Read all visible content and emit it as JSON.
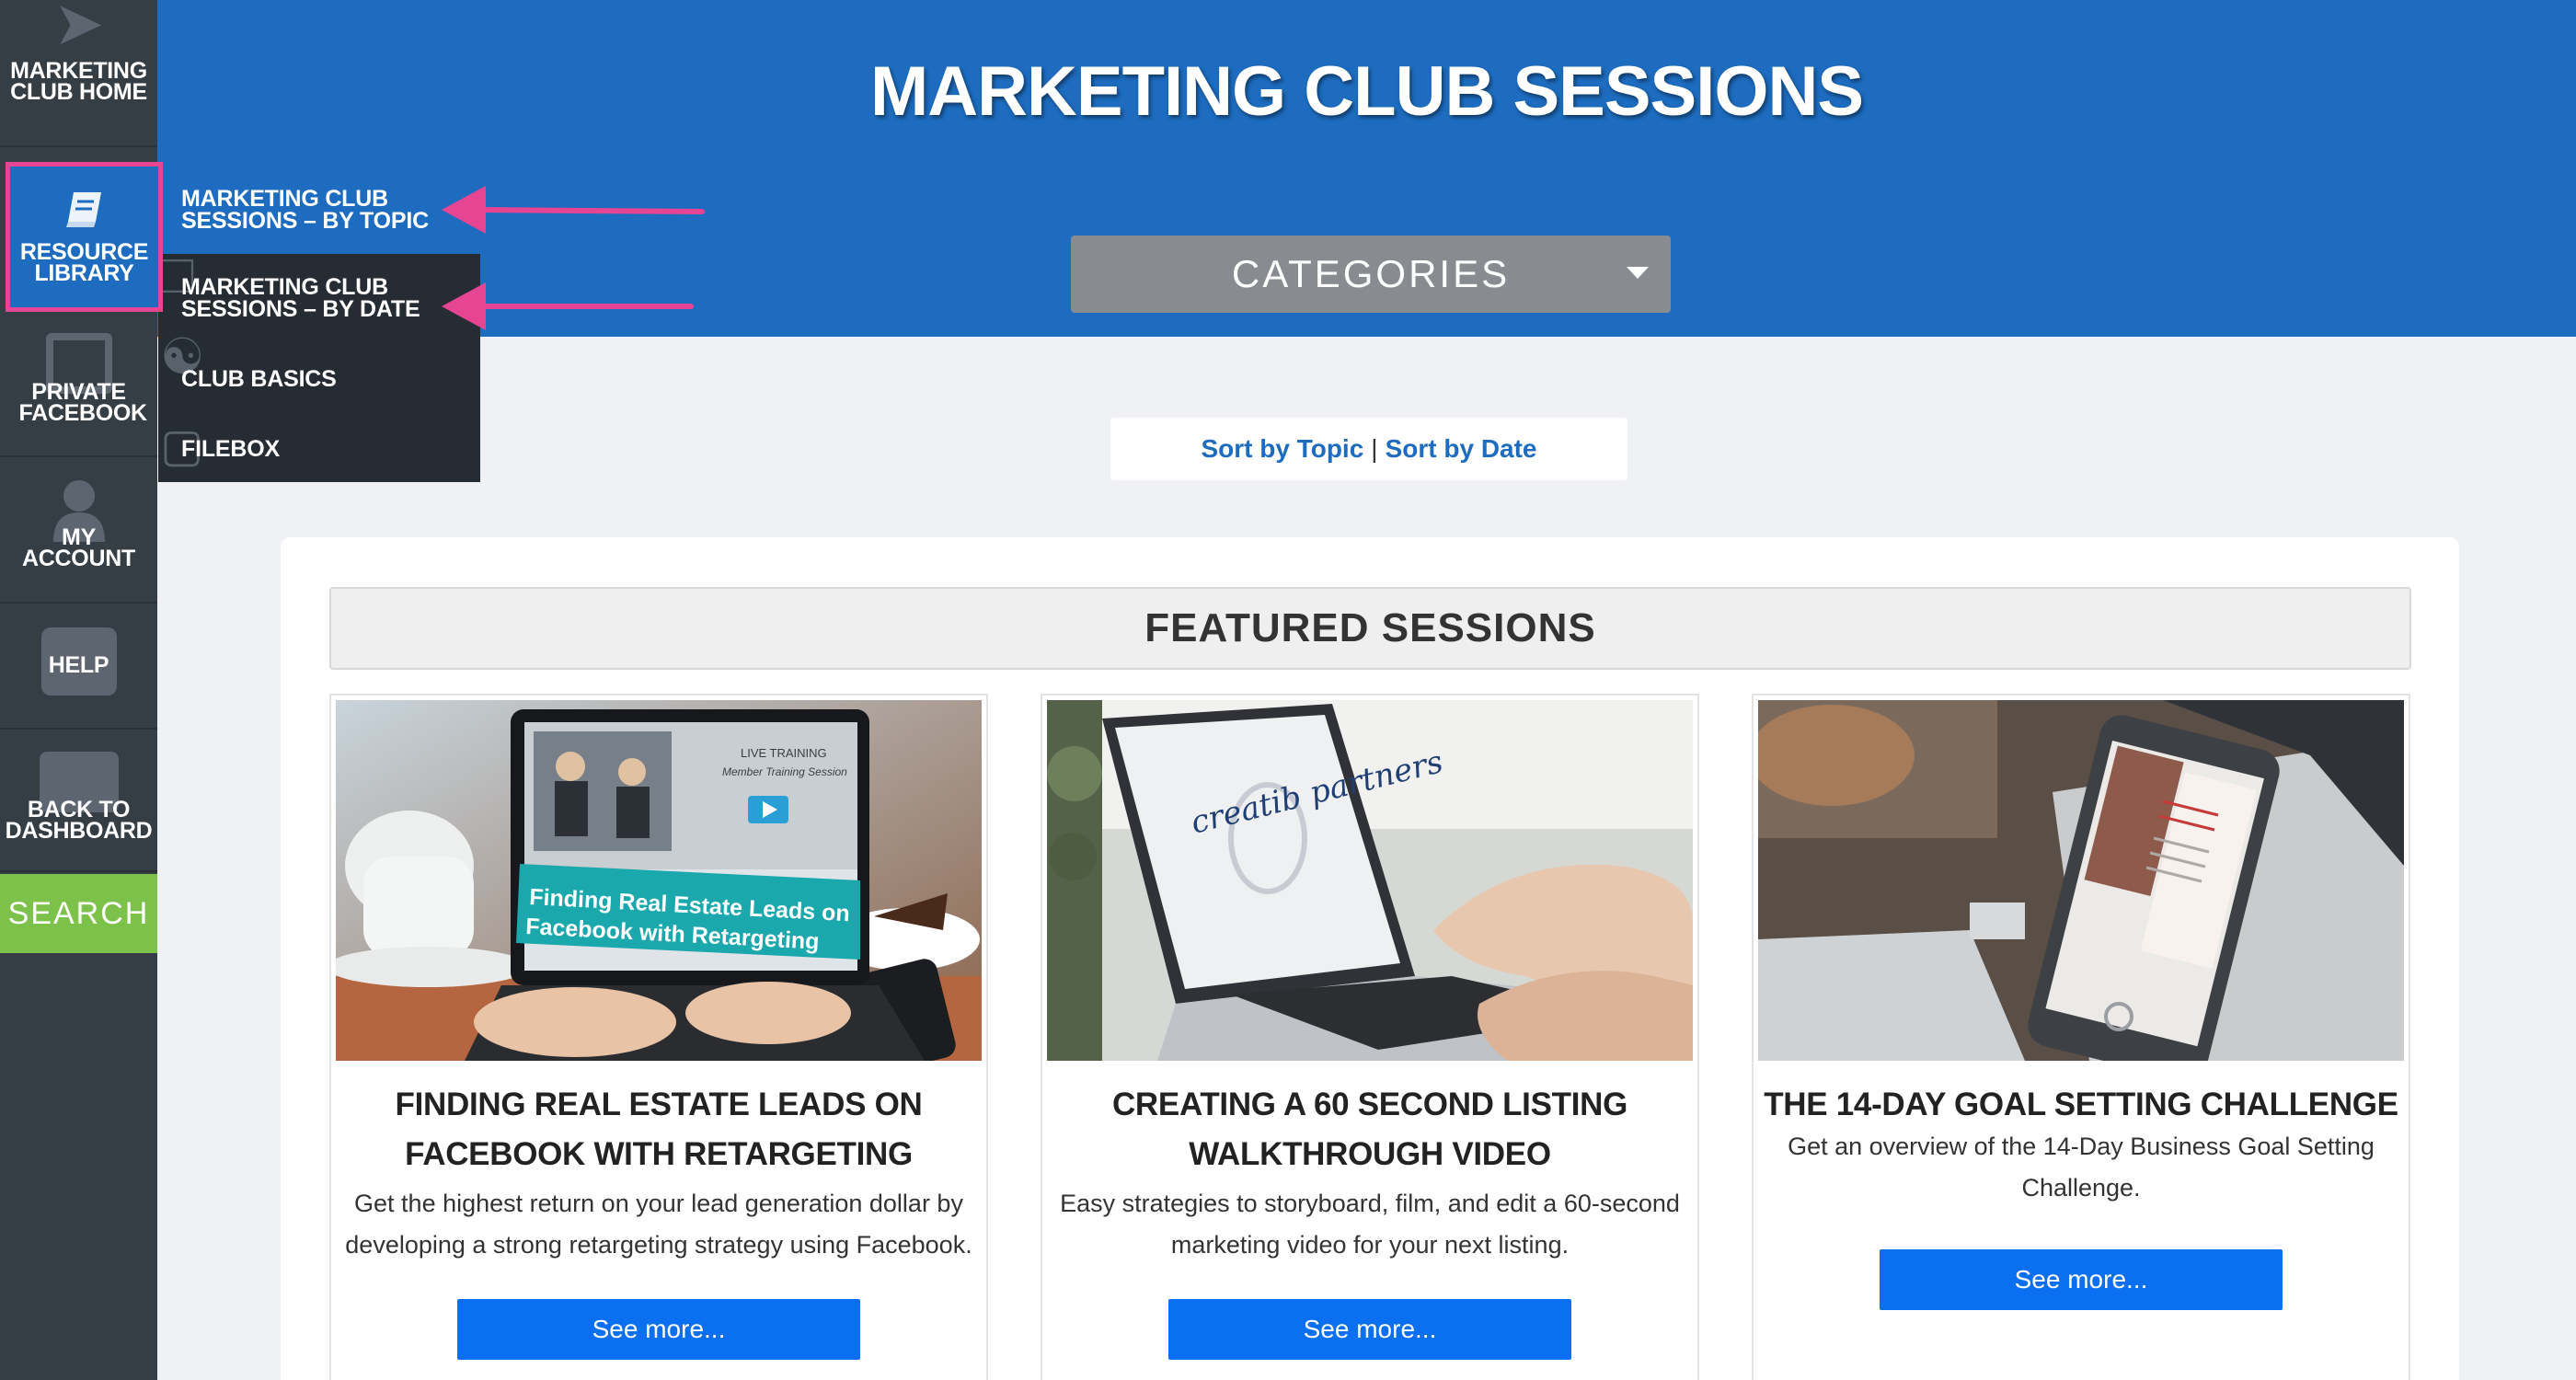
{
  "sidebar": {
    "home_label": "MARKETING CLUB HOME",
    "library_label": "RESOURCE LIBRARY",
    "facebook_label": "PRIVATE FACEBOOK",
    "account_label": "MY ACCOUNT",
    "help_label": "HELP",
    "back_label": "BACK TO DASHBOARD",
    "search_label": "SEARCH"
  },
  "submenu": {
    "items": [
      {
        "label": "MARKETING CLUB SESSIONS – BY TOPIC"
      },
      {
        "label": "MARKETING CLUB SESSIONS – BY DATE"
      },
      {
        "label": "CLUB BASICS"
      },
      {
        "label": "FILEBOX"
      }
    ]
  },
  "header": {
    "title": "MARKETING CLUB SESSIONS",
    "categories_label": "CATEGORIES"
  },
  "sort": {
    "topic": "Sort by Topic",
    "separator": "|",
    "date": "Sort by Date"
  },
  "featured": {
    "heading": "FEATURED SESSIONS",
    "cards": [
      {
        "title": "FINDING REAL ESTATE LEADS ON FACEBOOK WITH RETARGETING",
        "description": "Get the highest return on your lead generation dollar by developing a strong retargeting strategy using Facebook.",
        "button": "See more...",
        "image_text": [
          "LIVE TRAINING",
          "Member Training Session",
          "Finding Real Estate Leads on",
          "Facebook with Retargeting"
        ]
      },
      {
        "title": "CREATING A 60 SECOND LISTING WALKTHROUGH VIDEO",
        "description": "Easy strategies to storyboard, film, and edit a 60-second marketing video for your next listing.",
        "button": "See more...",
        "image_text": [
          "creatib partners"
        ]
      },
      {
        "title": "THE 14-DAY GOAL SETTING CHALLENGE",
        "description": "Get an overview of the 14-Day Business Goal Setting Challenge.",
        "button": "See more..."
      }
    ]
  },
  "colors": {
    "sidebar_bg": "#353d45",
    "brand_blue": "#1d6cbf",
    "highlight_pink": "#e64594",
    "search_green": "#7cc24a",
    "button_blue": "#0a6ff0"
  },
  "icons": [
    "paper-plane-icon",
    "book-icon",
    "facebook-icon",
    "user-icon",
    "briefcase-icon",
    "dashboard-icon",
    "chevron-down-icon",
    "arrow-left-icon"
  ]
}
